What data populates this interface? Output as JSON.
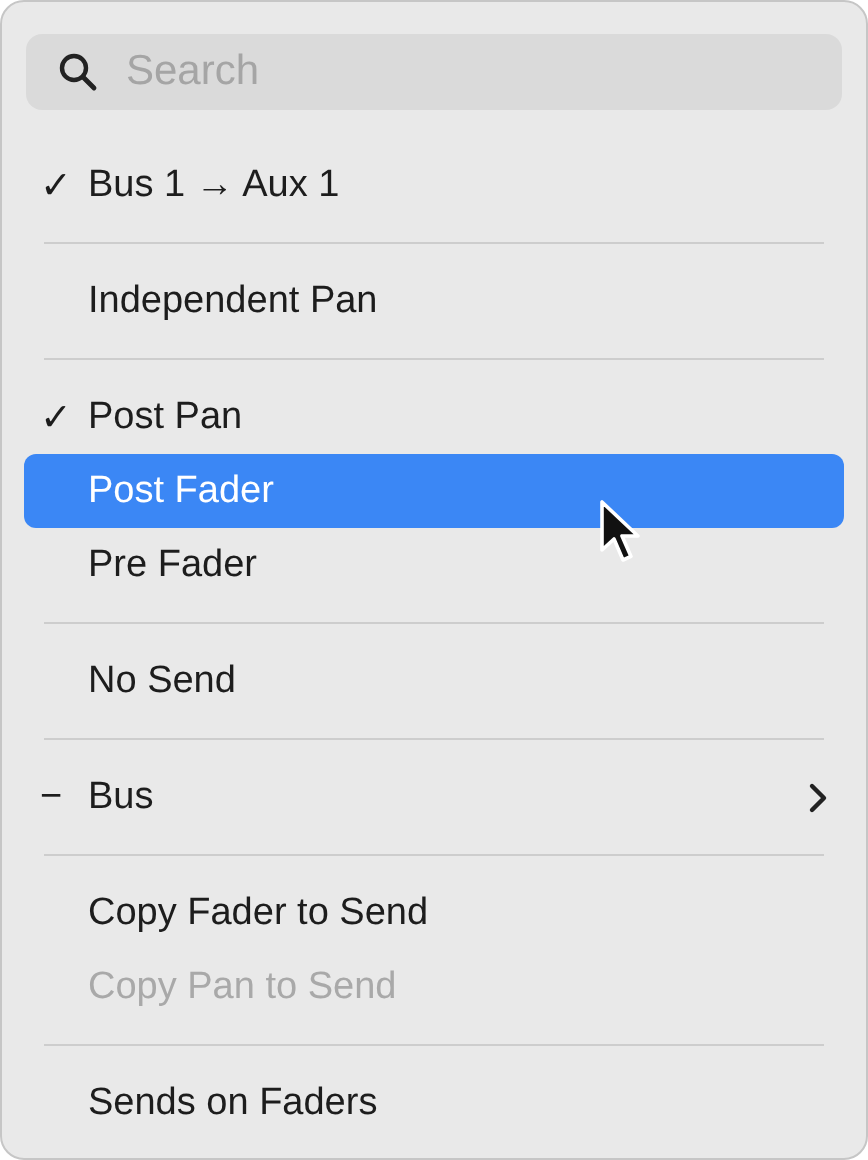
{
  "search": {
    "placeholder": "Search"
  },
  "sections": [
    [
      {
        "label": "Bus 1 → Aux 1",
        "mark": "✓",
        "selected": false,
        "disabled": false,
        "submenu": false
      }
    ],
    [
      {
        "label": "Independent Pan",
        "selected": false,
        "disabled": false,
        "submenu": false
      }
    ],
    [
      {
        "label": "Post Pan",
        "mark": "✓",
        "selected": false,
        "disabled": false,
        "submenu": false
      },
      {
        "label": "Post Fader",
        "selected": true,
        "disabled": false,
        "submenu": false
      },
      {
        "label": "Pre Fader",
        "selected": false,
        "disabled": false,
        "submenu": false
      }
    ],
    [
      {
        "label": "No Send",
        "selected": false,
        "disabled": false,
        "submenu": false
      }
    ],
    [
      {
        "label": "Bus",
        "mark": "−",
        "selected": false,
        "disabled": false,
        "submenu": true
      }
    ],
    [
      {
        "label": "Copy Fader to Send",
        "selected": false,
        "disabled": false,
        "submenu": false
      },
      {
        "label": "Copy Pan to Send",
        "selected": false,
        "disabled": true,
        "submenu": false
      }
    ],
    [
      {
        "label": "Sends on Faders",
        "selected": false,
        "disabled": false,
        "submenu": false
      }
    ]
  ]
}
